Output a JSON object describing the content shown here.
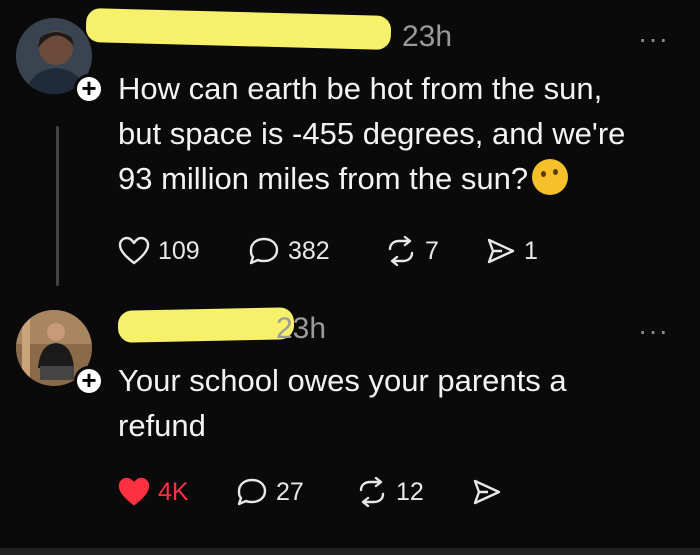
{
  "posts": [
    {
      "time": "23h",
      "more": "···",
      "lines": [
        "How can earth be hot from the sun,",
        "but space is -455 degrees, and we're",
        "93 million miles from the sun?"
      ],
      "emoji": "thinking-face",
      "actions": {
        "likes": "109",
        "replies": "382",
        "reposts": "7",
        "shares": "1"
      },
      "liked": false
    },
    {
      "time": "23h",
      "more": "···",
      "lines": [
        "Your school owes your parents a",
        "refund"
      ],
      "actions": {
        "likes": "4K",
        "replies": "27",
        "reposts": "12"
      },
      "liked": true
    }
  ],
  "colors": {
    "like_active": "#ff3040",
    "redaction": "#f7f06a",
    "muted": "#9a9a9a"
  }
}
